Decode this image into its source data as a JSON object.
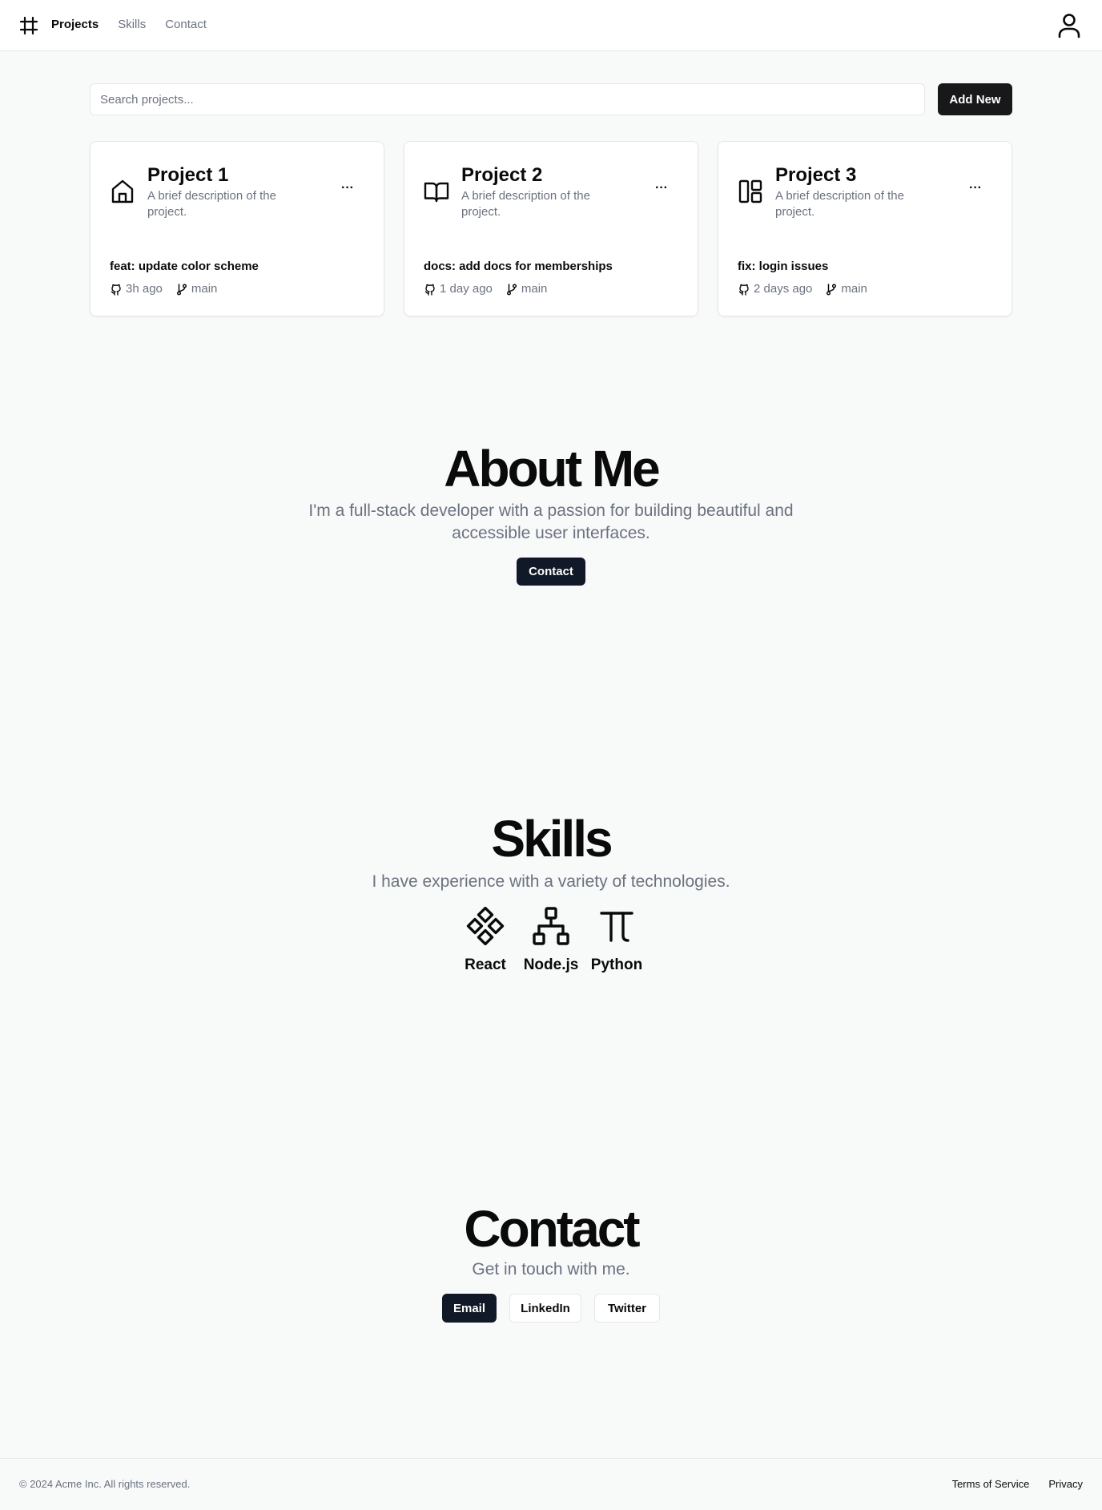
{
  "nav": {
    "items": [
      {
        "label": "Projects",
        "active": true
      },
      {
        "label": "Skills",
        "active": false
      },
      {
        "label": "Contact",
        "active": false
      }
    ],
    "logo_icon": "hash-frame-icon",
    "user_icon": "user-icon"
  },
  "search": {
    "placeholder": "Search projects...",
    "value": ""
  },
  "add_button": "Add New",
  "projects": [
    {
      "title": "Project 1",
      "description": "A brief description of the project.",
      "icon": "home-icon",
      "commit": "feat: update color scheme",
      "time": "3h ago",
      "branch": "main",
      "more": "···"
    },
    {
      "title": "Project 2",
      "description": "A brief description of the project.",
      "icon": "book-open-icon",
      "commit": "docs: add docs for memberships",
      "time": "1 day ago",
      "branch": "main",
      "more": "···"
    },
    {
      "title": "Project 3",
      "description": "A brief description of the project.",
      "icon": "layout-icon",
      "commit": "fix: login issues",
      "time": "2 days ago",
      "branch": "main",
      "more": "···"
    }
  ],
  "about": {
    "title": "About Me",
    "text_line1": "I'm a full-stack developer with a passion for building beautiful and",
    "text_line2": "accessible user interfaces.",
    "button": "Contact"
  },
  "skills": {
    "title": "Skills",
    "subtitle": "I have experience with a variety of technologies.",
    "items": [
      {
        "label": "React",
        "icon": "diamonds-icon"
      },
      {
        "label": "Node.js",
        "icon": "network-icon"
      },
      {
        "label": "Python",
        "icon": "pi-icon"
      }
    ]
  },
  "contact": {
    "title": "Contact",
    "subtitle": "Get in touch with me.",
    "buttons": [
      "Email",
      "LinkedIn",
      "Twitter"
    ]
  },
  "footer": {
    "copyright": "© 2024 Acme Inc. All rights reserved.",
    "links": [
      "Terms of Service",
      "Privacy"
    ]
  },
  "colors": {
    "background": "#f8f9f9",
    "primary_button": "#111827",
    "muted_text": "#6b7280",
    "border": "#e5e7eb"
  }
}
